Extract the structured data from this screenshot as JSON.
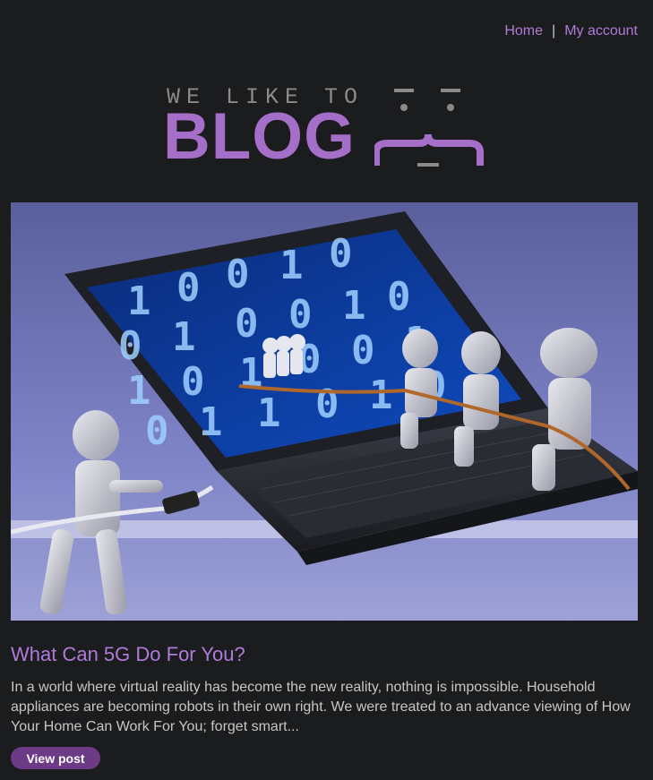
{
  "nav": {
    "home_label": "Home",
    "separator": "|",
    "account_label": "My account"
  },
  "logo": {
    "small_text": "WE LIKE TO",
    "big_text": "BLOG"
  },
  "post": {
    "title": "What Can 5G Do For You?",
    "summary": "In a world where virtual reality has become the new reality, nothing is impossible. Household appliances are becoming robots in their own right. We were treated to an advance viewing of How Your Home Can Work For You; forget smart...",
    "button_label": "View post"
  },
  "colors": {
    "background": "#1b1c1e",
    "accent": "#b07ad8",
    "logo_purple": "#a56ec8",
    "button": "#6d3a86"
  }
}
